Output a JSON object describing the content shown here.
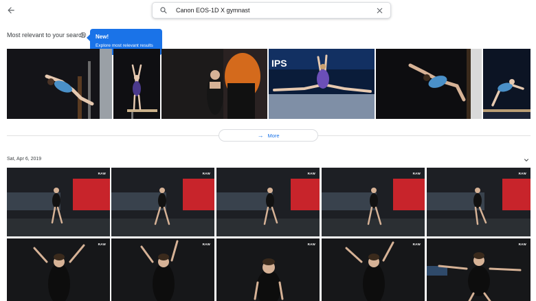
{
  "search": {
    "query": "Canon EOS-1D X gymnast"
  },
  "relevant": {
    "title": "Most relevant to your search",
    "tooltip_title": "New!",
    "tooltip_text": "Explore most relevant results"
  },
  "more": {
    "label": "More"
  },
  "date_group": {
    "label": "Sat, Apr 6, 2019"
  },
  "badge": {
    "raw": "RAW"
  },
  "colors": {
    "accent": "#1a73e8",
    "leotard_light_blue": "#4a90c8",
    "leotard_purple": "#6b4fb8",
    "arena_red": "#c8242b",
    "floor": "#2b2f33"
  }
}
